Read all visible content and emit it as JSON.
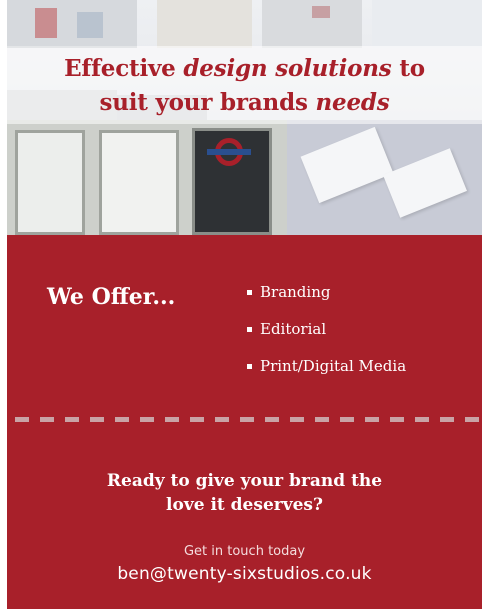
{
  "header": {
    "headline_line1_a": "Effective ",
    "headline_line1_em": "design solutions",
    "headline_line1_b": " to",
    "headline_line2_a": "suit your brands ",
    "headline_line2_em": "needs"
  },
  "offer": {
    "title": "We Offer...",
    "services": [
      "Branding",
      "Editorial",
      "Print/Digital Media"
    ]
  },
  "cta": {
    "line1": "Ready to give your brand the",
    "line2": "love it deserves?"
  },
  "contact": {
    "label": "Get in touch today",
    "email": "ben@twenty-sixstudios.co.uk"
  },
  "colors": {
    "brand_red": "#a8202a",
    "text_white": "#ffffff"
  }
}
